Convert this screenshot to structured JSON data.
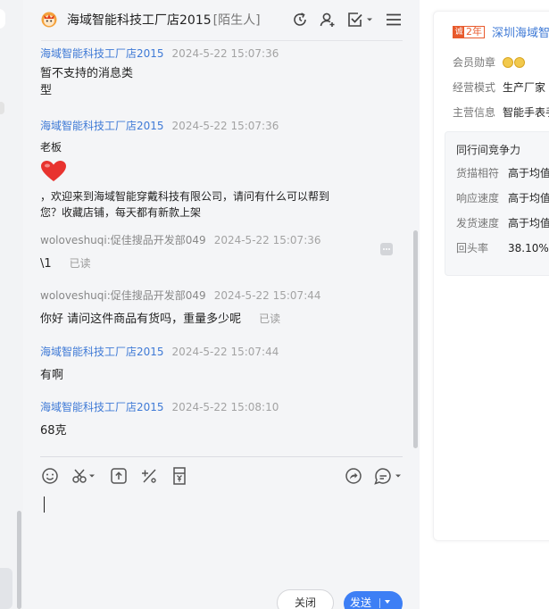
{
  "chat": {
    "title": "海域智能科技工厂店2015",
    "tag": "[陌生人]",
    "header_icons": [
      "refresh-icon",
      "add-contact-icon",
      "task-check-icon",
      "menu-icon"
    ],
    "messages": [
      {
        "sender": "海域智能科技工厂店2015",
        "time": "2024-5-22 15:07:36",
        "text_lines": [
          "暂不支持的消息类",
          "型"
        ]
      },
      {
        "sender": "海域智能科技工厂店2015",
        "time": "2024-5-22 15:07:36",
        "text": "老板",
        "body_lines": [
          "，欢迎来到海域智能穿戴科技有限公司，请问有什么可以帮到",
          "您？收藏店铺，每天都有新款上架"
        ]
      },
      {
        "sender": "woloveshuqi:促佳搜品开发部049",
        "time": "2024-5-22 15:07:36",
        "text": "\\1",
        "status": "已读"
      },
      {
        "sender": "woloveshuqi:促佳搜品开发部049",
        "time": "2024-5-22 15:07:44",
        "text": "你好 请问这件商品有货吗，重量多少呢",
        "status": "已读"
      },
      {
        "sender": "海域智能科技工厂店2015",
        "time": "2024-5-22 15:07:44",
        "text": "有啊"
      },
      {
        "sender": "海域智能科技工厂店2015",
        "time": "2024-5-22 15:08:10",
        "text": "68克"
      }
    ],
    "toolbar": [
      "emoji-icon",
      "scissors-icon",
      "upload-icon",
      "percent-icon",
      "coupon-icon",
      "share-icon",
      "quick-reply-icon"
    ],
    "close_label": "关闭",
    "send_label": "发送"
  },
  "info": {
    "years": "2年",
    "shop_name": "深圳海域智",
    "rows": [
      {
        "label": "会员勋章",
        "value": ""
      },
      {
        "label": "经营模式",
        "value": "生产厂家"
      },
      {
        "label": "主营信息",
        "value": "智能手表手"
      }
    ],
    "compete": {
      "title": "同行间竞争力",
      "rows": [
        {
          "label": "货描相符",
          "value": "高于均值"
        },
        {
          "label": "响应速度",
          "value": "高于均值"
        },
        {
          "label": "发货速度",
          "value": "高于均值"
        },
        {
          "label": "回头率",
          "value": "38.10%"
        }
      ]
    }
  },
  "colors": {
    "accent": "#3d7ff5",
    "shop_link": "#3f7ad6",
    "badge": "#e85a2c"
  }
}
